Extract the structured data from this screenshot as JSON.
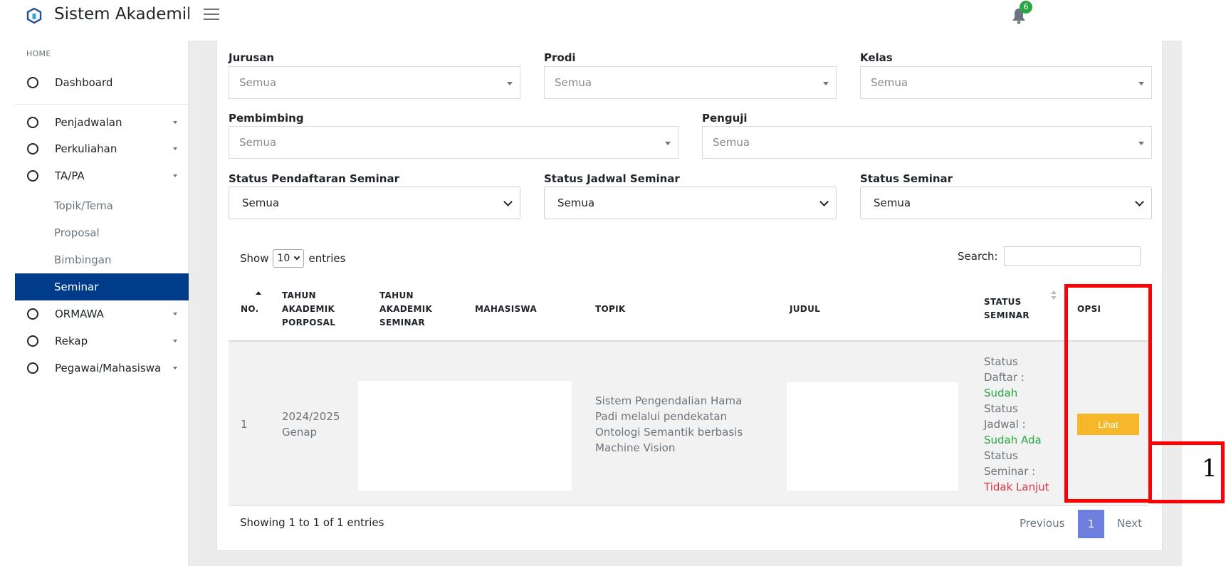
{
  "header": {
    "title": "Sistem Akademik",
    "notification_count": "6"
  },
  "sidebar": {
    "section": "HOME",
    "items": [
      {
        "label": "Dashboard"
      },
      {
        "label": "Penjadwalan"
      },
      {
        "label": "Perkuliahan"
      },
      {
        "label": "TA/PA"
      },
      {
        "label": "ORMAWA"
      },
      {
        "label": "Rekap"
      },
      {
        "label": "Pegawai/Mahasiswa"
      }
    ],
    "subitems": [
      {
        "label": "Topik/Tema"
      },
      {
        "label": "Proposal"
      },
      {
        "label": "Bimbingan"
      },
      {
        "label": "Seminar"
      }
    ]
  },
  "filters": {
    "jurusan": {
      "label": "Jurusan",
      "value": "Semua"
    },
    "prodi": {
      "label": "Prodi",
      "value": "Semua"
    },
    "kelas": {
      "label": "Kelas",
      "value": "Semua"
    },
    "pembimbing": {
      "label": "Pembimbing",
      "value": "Semua"
    },
    "penguji": {
      "label": "Penguji",
      "value": "Semua"
    },
    "status_pendaftaran": {
      "label": "Status Pendaftaran Seminar",
      "value": "Semua"
    },
    "status_jadwal": {
      "label": "Status Jadwal Seminar",
      "value": "Semua"
    },
    "status_seminar": {
      "label": "Status Seminar",
      "value": "Semua"
    }
  },
  "table_controls": {
    "show": "Show",
    "length": "10",
    "entries": "entries",
    "search_label": "Search:"
  },
  "table": {
    "headers": {
      "no": "NO.",
      "tahun_proposal": [
        "TAHUN",
        "AKADEMIK",
        "PORPOSAL"
      ],
      "tahun_seminar": [
        "TAHUN",
        "AKADEMIK",
        "SEMINAR"
      ],
      "mahasiswa": "MAHASISWA",
      "topik": "TOPIK",
      "judul": "JUDUL",
      "status": [
        "STATUS",
        "SEMINAR"
      ],
      "opsi": "OPSI"
    },
    "rows": [
      {
        "no": "1",
        "tahun": [
          "2024/2025",
          "Genap"
        ],
        "topik": [
          "Sistem Pengendalian Hama",
          "Padi melalui pendekatan",
          "Ontologi Semantik berbasis",
          "Machine Vision"
        ],
        "status": {
          "daftar_label": [
            "Status",
            "Daftar :"
          ],
          "daftar_value": "Sudah",
          "jadwal_label": [
            "Status",
            "Jadwal :"
          ],
          "jadwal_value": "Sudah Ada",
          "seminar_label": [
            "Status",
            "Seminar :"
          ],
          "seminar_value": "Tidak Lanjut"
        },
        "action": "Lihat"
      }
    ]
  },
  "footer": {
    "info": "Showing 1 to 1 of 1 entries",
    "previous": "Previous",
    "page": "1",
    "next": "Next"
  },
  "annotation": {
    "label": "1",
    "color": "#ff0000"
  },
  "colors": {
    "sidebar_active": "#003c8a",
    "button": "#f7b72b",
    "pagination_active": "#6f7fe0",
    "status_positive": "#28a745",
    "status_negative": "#dc3545"
  }
}
